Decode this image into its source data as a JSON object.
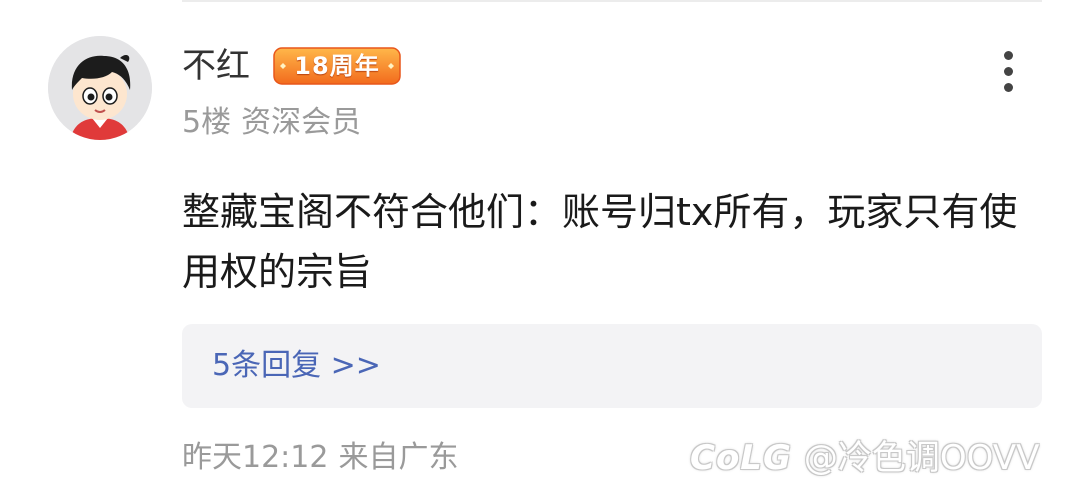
{
  "post": {
    "username": "不红",
    "badge": "18周年",
    "floor": "5楼",
    "member_level": "资深会员",
    "content": "整藏宝阁不符合他们：账号归tx所有，玩家只有使用权的宗旨",
    "replies_link": "5条回复 >>",
    "time": "昨天12:12",
    "location": "来自广东"
  },
  "watermark": {
    "logo": "CoLG",
    "handle": "@冷色调OOVV"
  },
  "colors": {
    "link": "#4a66b6",
    "muted": "#9a9a9a",
    "badge_gradient": [
      "#ffb74a",
      "#f26b1d"
    ]
  },
  "icons": {
    "more": "more-vertical-icon",
    "avatar": "cartoon-boy-avatar"
  }
}
